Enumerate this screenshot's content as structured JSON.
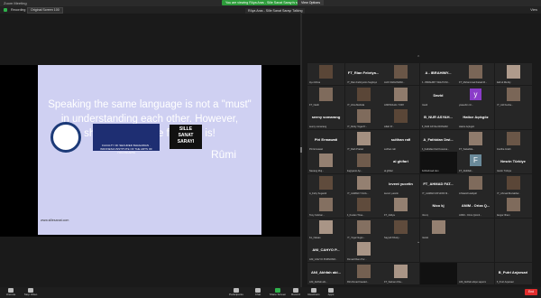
{
  "window": {
    "app_title": "Zoom Meeting"
  },
  "share_banner": "You are viewing Rüya Aras - Sille Sanat Sarayı's screen",
  "stop_share": "View Options",
  "infobar": {
    "recording": "Recording",
    "viewer": "Original Screen 100",
    "view": "View"
  },
  "speaker_badge": "Rüya Aras - Sille Sanat Sarayı Talking",
  "slide": {
    "quote": "Speaking the same language is not a \"must\" in understanding each other. However, sharing the same feelings is!",
    "author": "Rûmi",
    "url": "www.sillesanat.com",
    "logo2_text": "FACULTY OF SECURED BHAGAWAN · INDONESIA INSTITUTE OF THE ARTS OF YOGYAKARTA",
    "logo3_line1": "SILLE",
    "logo3_line2": "SANAT",
    "logo3_line3": "SARAYI"
  },
  "gallery": {
    "rows": [
      [
        {
          "name": "",
          "caption": "Ayu Ghina",
          "kind": "photo"
        },
        {
          "name": "FT_Rian Febriya...",
          "caption": "FT_Rian Febriyanto Sugitoyo",
          "kind": "text"
        },
        {
          "name": "",
          "caption": "ALIF KAKHINAWI...",
          "kind": "photo"
        },
        {
          "name": "A - IBRAHIMY...",
          "caption": "A - IBRAHIMY WAHYUNI...",
          "kind": "text"
        },
        {
          "name": "",
          "caption": "FT_Muhammad Faisal Ri...",
          "kind": "photo"
        },
        {
          "name": "",
          "caption": "Sahrul Riezky",
          "kind": "photo"
        }
      ],
      [
        {
          "name": "",
          "caption": "FT_Nardi",
          "kind": "photo"
        },
        {
          "name": "",
          "caption": "FT_Zora Melinda",
          "kind": "photo"
        },
        {
          "name": "",
          "caption": "ANIFSCHAL YORY",
          "kind": "photo"
        },
        {
          "name": "David",
          "caption": "David",
          "kind": "text"
        },
        {
          "name": "y",
          "caption": "yaseebin riz...",
          "kind": "avatar",
          "color": "#8a3cc8"
        },
        {
          "name": "",
          "caption": "FT_Adi Kesha...",
          "kind": "photo"
        }
      ],
      [
        {
          "name": "seeny somarang",
          "caption": "seeny somarang",
          "kind": "text"
        },
        {
          "name": "",
          "caption": "FT_Dicky Yoga Pr...",
          "kind": "photo"
        },
        {
          "name": "",
          "caption": "Lillah Pr...",
          "kind": "photo"
        },
        {
          "name": "B_NUR ASYAH...",
          "caption": "B_NUR ASYAH RONAIM",
          "kind": "text"
        },
        {
          "name": "Hatice Açıkgöz",
          "caption": "Hatice Açıkgöz",
          "kind": "text"
        },
        {
          "name": "",
          "caption": "",
          "kind": "empty"
        }
      ],
      [
        {
          "name": "Piri Ermawati",
          "caption": "Piri Ermawati",
          "kind": "text"
        },
        {
          "name": "",
          "caption": "FT_Diah Pratiwi",
          "kind": "photo"
        },
        {
          "name": "sulthan rafi",
          "caption": "sulthan rafi",
          "kind": "text"
        },
        {
          "name": "A_Fathidan Dwi...",
          "caption": "A_Fathidan Dwi Kusuma...",
          "kind": "text"
        },
        {
          "name": "",
          "caption": "FT_Salsabila...",
          "kind": "photo"
        },
        {
          "name": "",
          "caption": "Ravitha Indah",
          "kind": "photo"
        }
      ],
      [
        {
          "name": "",
          "caption": "Nanang Muj...",
          "kind": "photo"
        },
        {
          "name": "",
          "caption": "Sugiyanto Ap...",
          "kind": "photo"
        },
        {
          "name": "al ghifari",
          "caption": "al ghifari",
          "kind": "text"
        },
        {
          "name": "",
          "caption": "Ad.Rahmad Hsn",
          "kind": "dark"
        },
        {
          "name": "F",
          "caption": "FT_Abdillah...",
          "kind": "avatar",
          "color": "#6a8a9a"
        },
        {
          "name": "Nesrin Türkiye",
          "caption": "Nesrin Türkiye",
          "kind": "text"
        }
      ],
      [
        {
          "name": "",
          "caption": "A_Feby Sugandi",
          "kind": "photo"
        },
        {
          "name": "",
          "caption": "FT_AHMAD YULIA...",
          "kind": "photo"
        },
        {
          "name": "levent yucetin",
          "caption": "levent yucetin",
          "kind": "text"
        },
        {
          "name": "FT_AHMAD FAT...",
          "caption": "FT_AHMAD FATHONI M...",
          "kind": "text"
        },
        {
          "name": "",
          "caption": "A Masiid Hadiyah",
          "kind": "photo"
        },
        {
          "name": "",
          "caption": "FT_Ahmad Muzakhar...",
          "kind": "photo"
        }
      ],
      [
        {
          "name": "",
          "caption": "Tony Febrian...",
          "kind": "photo"
        },
        {
          "name": "",
          "caption": "A_Kuslan Trisa...",
          "kind": "photo"
        },
        {
          "name": "",
          "caption": "FT_Aditya",
          "kind": "photo"
        },
        {
          "name": "Nico kj",
          "caption": "Nico kj",
          "kind": "text"
        },
        {
          "name": "ANIM - Oriza Q...",
          "caption": "ANIM - Oriza Qoimil...",
          "kind": "text"
        },
        {
          "name": "",
          "caption": "Jangar Ilham",
          "kind": "photo"
        }
      ],
      [
        {
          "name": "",
          "caption": "Ko_Nawas",
          "kind": "photo"
        },
        {
          "name": "",
          "caption": "FT_Yoga Nugro...",
          "kind": "photo"
        },
        {
          "name": "",
          "caption": "Sayyidi Khairy...",
          "kind": "photo"
        },
        {
          "name": "",
          "caption": "Nando",
          "kind": "photo"
        },
        {
          "name": "",
          "caption": "",
          "kind": "empty"
        },
        {
          "name": "",
          "caption": "",
          "kind": "empty"
        }
      ],
      [
        {
          "name": "ANI_CAHYO P...",
          "caption": "ANI_CAHYO PURNOMO...",
          "kind": "text"
        },
        {
          "name": "",
          "caption": "Ahmad Ilham Pur...",
          "kind": "photo"
        },
        {
          "name": "",
          "caption": "",
          "kind": "empty"
        },
        {
          "name": "",
          "caption": "",
          "kind": "empty"
        },
        {
          "name": "",
          "caption": "",
          "kind": "empty"
        },
        {
          "name": "",
          "caption": "",
          "kind": "empty"
        }
      ],
      [
        {
          "name": "ANI_Akhfah abi...",
          "caption": "ANI_Akhfah abi...",
          "kind": "text"
        },
        {
          "name": "",
          "caption": "ANI Ahmad Fawaid...",
          "kind": "photo"
        },
        {
          "name": "",
          "caption": "FT_Salman Kha...",
          "kind": "photo"
        },
        {
          "name": "",
          "caption": "",
          "kind": "dark"
        },
        {
          "name": "",
          "caption": "ANI_Akhfah abipo saputro",
          "kind": "empty"
        },
        {
          "name": "B_Putri Anjarsari",
          "caption": "B_Putri Anjarsari",
          "kind": "text"
        }
      ]
    ]
  },
  "toolbar": {
    "unmute": "Unmute",
    "stop_video": "Stop Video",
    "participants": "Participants",
    "participants_count": "102",
    "chat": "Chat",
    "share_screen": "Share Screen",
    "record": "Record",
    "reactions": "Reactions",
    "apps": "Apps",
    "end": "End"
  }
}
